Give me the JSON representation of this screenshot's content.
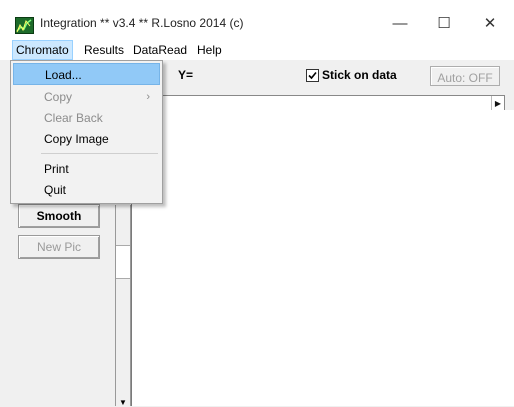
{
  "window": {
    "title": "Integration ** v3.4 ** R.Losno 2014 (c)",
    "minimize_glyph": "—",
    "maximize_glyph": "☐",
    "close_glyph": "✕"
  },
  "menubar": {
    "items": [
      {
        "label": "Chromato"
      },
      {
        "label": "Results"
      },
      {
        "label": "DataRead"
      },
      {
        "label": "Help"
      }
    ]
  },
  "chromato_menu": {
    "items": [
      {
        "label": "Load...",
        "enabled": true,
        "highlighted": true
      },
      {
        "label": "Copy",
        "enabled": false,
        "submenu_arrow": "›"
      },
      {
        "label": "Clear Back",
        "enabled": false
      },
      {
        "label": "Copy Image",
        "enabled": true
      },
      {
        "label": "Print",
        "enabled": true
      },
      {
        "label": "Quit",
        "enabled": true
      }
    ]
  },
  "toolbar": {
    "y_label": "Y=",
    "stick_on_data_label": "Stick on data",
    "stick_on_data_checked": true,
    "auto_button_label": "Auto: OFF"
  },
  "side_panel": {
    "smooth_label": "Smooth",
    "new_pic_label": "New Pic"
  },
  "scrollbar": {
    "right_arrow": "▶",
    "down_arrow": "▼"
  },
  "colors": {
    "highlight": "#91c9f7",
    "active_menu": "#cce8ff",
    "disabled_text": "#8c8c8c"
  }
}
